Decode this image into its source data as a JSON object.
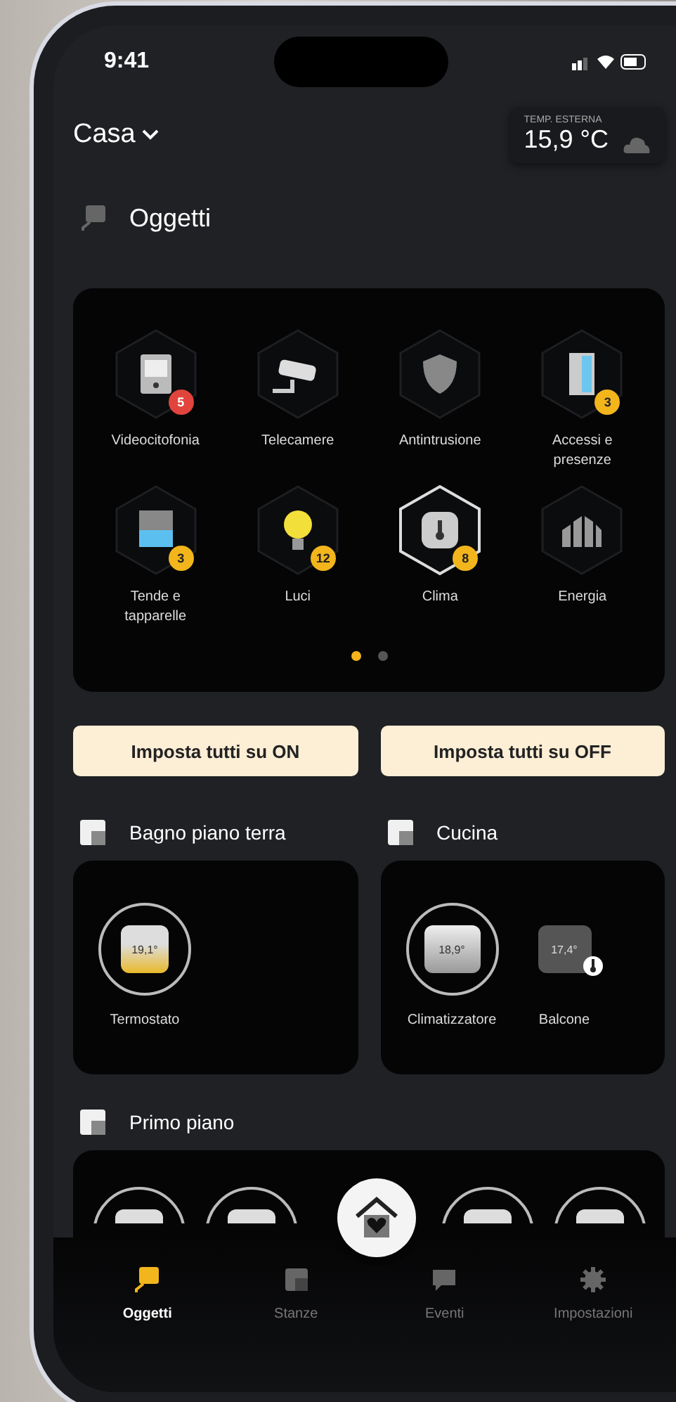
{
  "status_bar": {
    "time": "9:41"
  },
  "header": {
    "home": "Casa",
    "weather": {
      "label": "TEMP. ESTERNA",
      "value": "15,9 °C"
    }
  },
  "section": {
    "title": "Oggetti"
  },
  "categories": [
    {
      "kind": "intercom",
      "label": "Videocitofonia",
      "badge": "5",
      "color": "#e0443c",
      "selected": false
    },
    {
      "kind": "camera",
      "label": "Telecamere",
      "selected": false
    },
    {
      "kind": "shield",
      "label": "Antintrusione",
      "selected": false
    },
    {
      "kind": "door",
      "label": "Accessi e presenze",
      "badge": "3",
      "color": "#f2b51c",
      "selected": false
    },
    {
      "kind": "blind",
      "label": "Tende e tapparelle",
      "badge": "3",
      "color": "#f2b51c",
      "selected": false
    },
    {
      "kind": "bulb",
      "label": "Luci",
      "badge": "12",
      "color": "#f2b51c",
      "selected": false
    },
    {
      "kind": "thermo",
      "label": "Clima",
      "badge": "8",
      "color": "#f2b51c",
      "selected": true
    },
    {
      "kind": "energy",
      "label": "Energia",
      "selected": false
    }
  ],
  "pager": [
    {
      "selected": true
    },
    {
      "selected": false
    }
  ],
  "actions": [
    "Imposta tutti su ON",
    "Imposta tutti su OFF"
  ],
  "rooms": [
    {
      "name": "Bagno piano terra",
      "devices": [
        {
          "kind": "thermostat",
          "reading": "19,1°",
          "label": "Termostato"
        }
      ]
    },
    {
      "name": "Cucina",
      "devices": [
        {
          "kind": "aircon",
          "reading": "18,9°",
          "label": "Climatizzatore"
        },
        {
          "kind": "sensor",
          "reading": "17,4°",
          "label": "Balcone"
        }
      ]
    }
  ],
  "floor": {
    "name": "Primo piano",
    "devices": [
      {
        "kind": "thermostat"
      },
      {
        "kind": "thermostat"
      },
      {
        "kind": "thermostat"
      },
      {
        "kind": "thermostat"
      }
    ]
  },
  "tabs": [
    {
      "kind": "objects",
      "label": "Oggetti",
      "selected": true
    },
    {
      "kind": "rooms",
      "label": "Stanze",
      "selected": false
    },
    {
      "kind": "events",
      "label": "Eventi",
      "selected": false
    },
    {
      "kind": "settings",
      "label": "Impostazioni",
      "selected": false
    }
  ]
}
